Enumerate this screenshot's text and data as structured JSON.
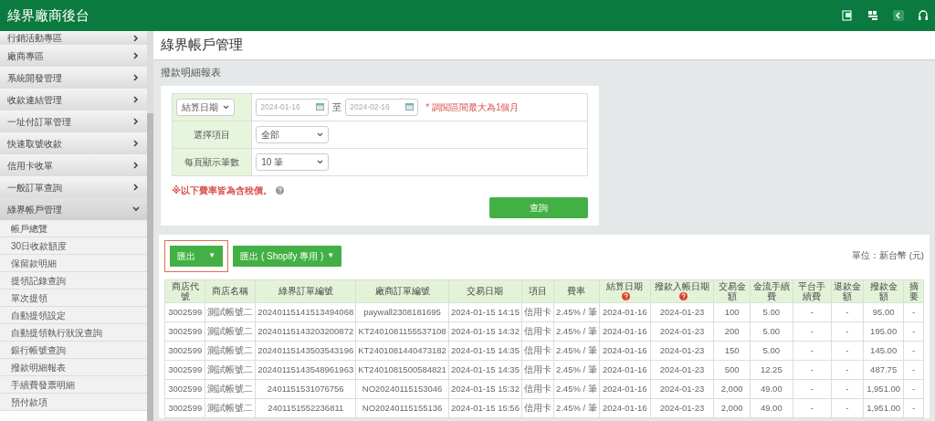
{
  "app_title": "綠界廠商後台",
  "sidebar": {
    "items": [
      {
        "label": "行銷活動專區",
        "expanded": false
      },
      {
        "label": "廠商專區",
        "expanded": false
      },
      {
        "label": "系統開發管理",
        "expanded": false
      },
      {
        "label": "收款連結管理",
        "expanded": false
      },
      {
        "label": "一址付訂單管理",
        "expanded": false
      },
      {
        "label": "快速取號收款",
        "expanded": false
      },
      {
        "label": "信用卡收單",
        "expanded": false
      },
      {
        "label": "一般訂單查詢",
        "expanded": false
      },
      {
        "label": "綠界帳戶管理",
        "expanded": true,
        "children": [
          {
            "label": "帳戶總覽"
          },
          {
            "label": "30日收款額度"
          },
          {
            "label": "保留款明細"
          },
          {
            "label": "提領記錄查詢"
          },
          {
            "label": "單次提領"
          },
          {
            "label": "自動提領設定"
          },
          {
            "label": "自動提領執行狀況查詢"
          },
          {
            "label": "銀行帳號查詢"
          },
          {
            "label": "撥款明細報表"
          },
          {
            "label": "手續費發票明細"
          },
          {
            "label": "預付款項"
          }
        ]
      }
    ]
  },
  "page_title": "綠界帳戶管理",
  "section_title": "撥款明細報表",
  "form": {
    "date_type": "結算日期",
    "date_from": "2024-01-16",
    "separator": "至",
    "date_to": "2024-02-16",
    "date_hint": "* 調閱區間最大為1個月",
    "item_label": "選擇項目",
    "item_value": "全部",
    "per_page_label": "每頁顯示筆數",
    "per_page_value": "10 筆",
    "tax_note": "※以下費率皆為含稅價。",
    "query_button": "查詢"
  },
  "export_buttons": [
    {
      "label": "匯出",
      "caret": "▼",
      "focused": true
    },
    {
      "label": "匯出 ( Shopify 專用 )",
      "caret": "▼",
      "focused": false
    }
  ],
  "unit": "單位：新台幣 (元)",
  "table": {
    "columns": [
      {
        "label": "商店代號",
        "help": false
      },
      {
        "label": "商店名稱",
        "help": false
      },
      {
        "label": "綠界訂單編號",
        "help": false
      },
      {
        "label": "廠商訂單編號",
        "help": false
      },
      {
        "label": "交易日期",
        "help": false
      },
      {
        "label": "項目",
        "help": false
      },
      {
        "label": "費率",
        "help": false
      },
      {
        "label": "結算日期",
        "help": true
      },
      {
        "label": "撥款入帳日期",
        "help": true
      },
      {
        "label": "交易金額",
        "help": false
      },
      {
        "label": "金流手續費",
        "help": false
      },
      {
        "label": "平台手續費",
        "help": false
      },
      {
        "label": "退款金額",
        "help": false
      },
      {
        "label": "撥款金額",
        "help": false
      },
      {
        "label": "摘要",
        "help": false
      }
    ],
    "rows": [
      [
        "3002599",
        "測試帳號二",
        "20240115141513494068",
        "paywall2308181695",
        "2024-01-15 14:15",
        "信用卡",
        "2.45% / 筆",
        "2024-01-16",
        "2024-01-23",
        "100",
        "5.00",
        "-",
        "-",
        "95.00",
        "-"
      ],
      [
        "3002599",
        "測試帳號二",
        "20240115143203200872",
        "KT2401081155537108",
        "2024-01-15 14:32",
        "信用卡",
        "2.45% / 筆",
        "2024-01-16",
        "2024-01-23",
        "200",
        "5.00",
        "-",
        "-",
        "195.00",
        "-"
      ],
      [
        "3002599",
        "測試帳號二",
        "20240115143503543196",
        "KT2401081440473182",
        "2024-01-15 14:35",
        "信用卡",
        "2.45% / 筆",
        "2024-01-16",
        "2024-01-23",
        "150",
        "5.00",
        "-",
        "-",
        "145.00",
        "-"
      ],
      [
        "3002599",
        "測試帳號二",
        "20240115143548961963",
        "KT2401081500584821",
        "2024-01-15 14:35",
        "信用卡",
        "2.45% / 筆",
        "2024-01-16",
        "2024-01-23",
        "500",
        "12.25",
        "-",
        "-",
        "487.75",
        "-"
      ],
      [
        "3002599",
        "測試帳號二",
        "2401151531076756",
        "NO20240115153046",
        "2024-01-15 15:32",
        "信用卡",
        "2.45% / 筆",
        "2024-01-16",
        "2024-01-23",
        "2,000",
        "49.00",
        "-",
        "-",
        "1,951.00",
        "-"
      ],
      [
        "3002599",
        "測試帳號二",
        "2401151552236811",
        "NO20240115155136",
        "2024-01-15 15:56",
        "信用卡",
        "2.45% / 筆",
        "2024-01-16",
        "2024-01-23",
        "2,000",
        "49.00",
        "-",
        "-",
        "1,951.00",
        "-"
      ]
    ]
  }
}
